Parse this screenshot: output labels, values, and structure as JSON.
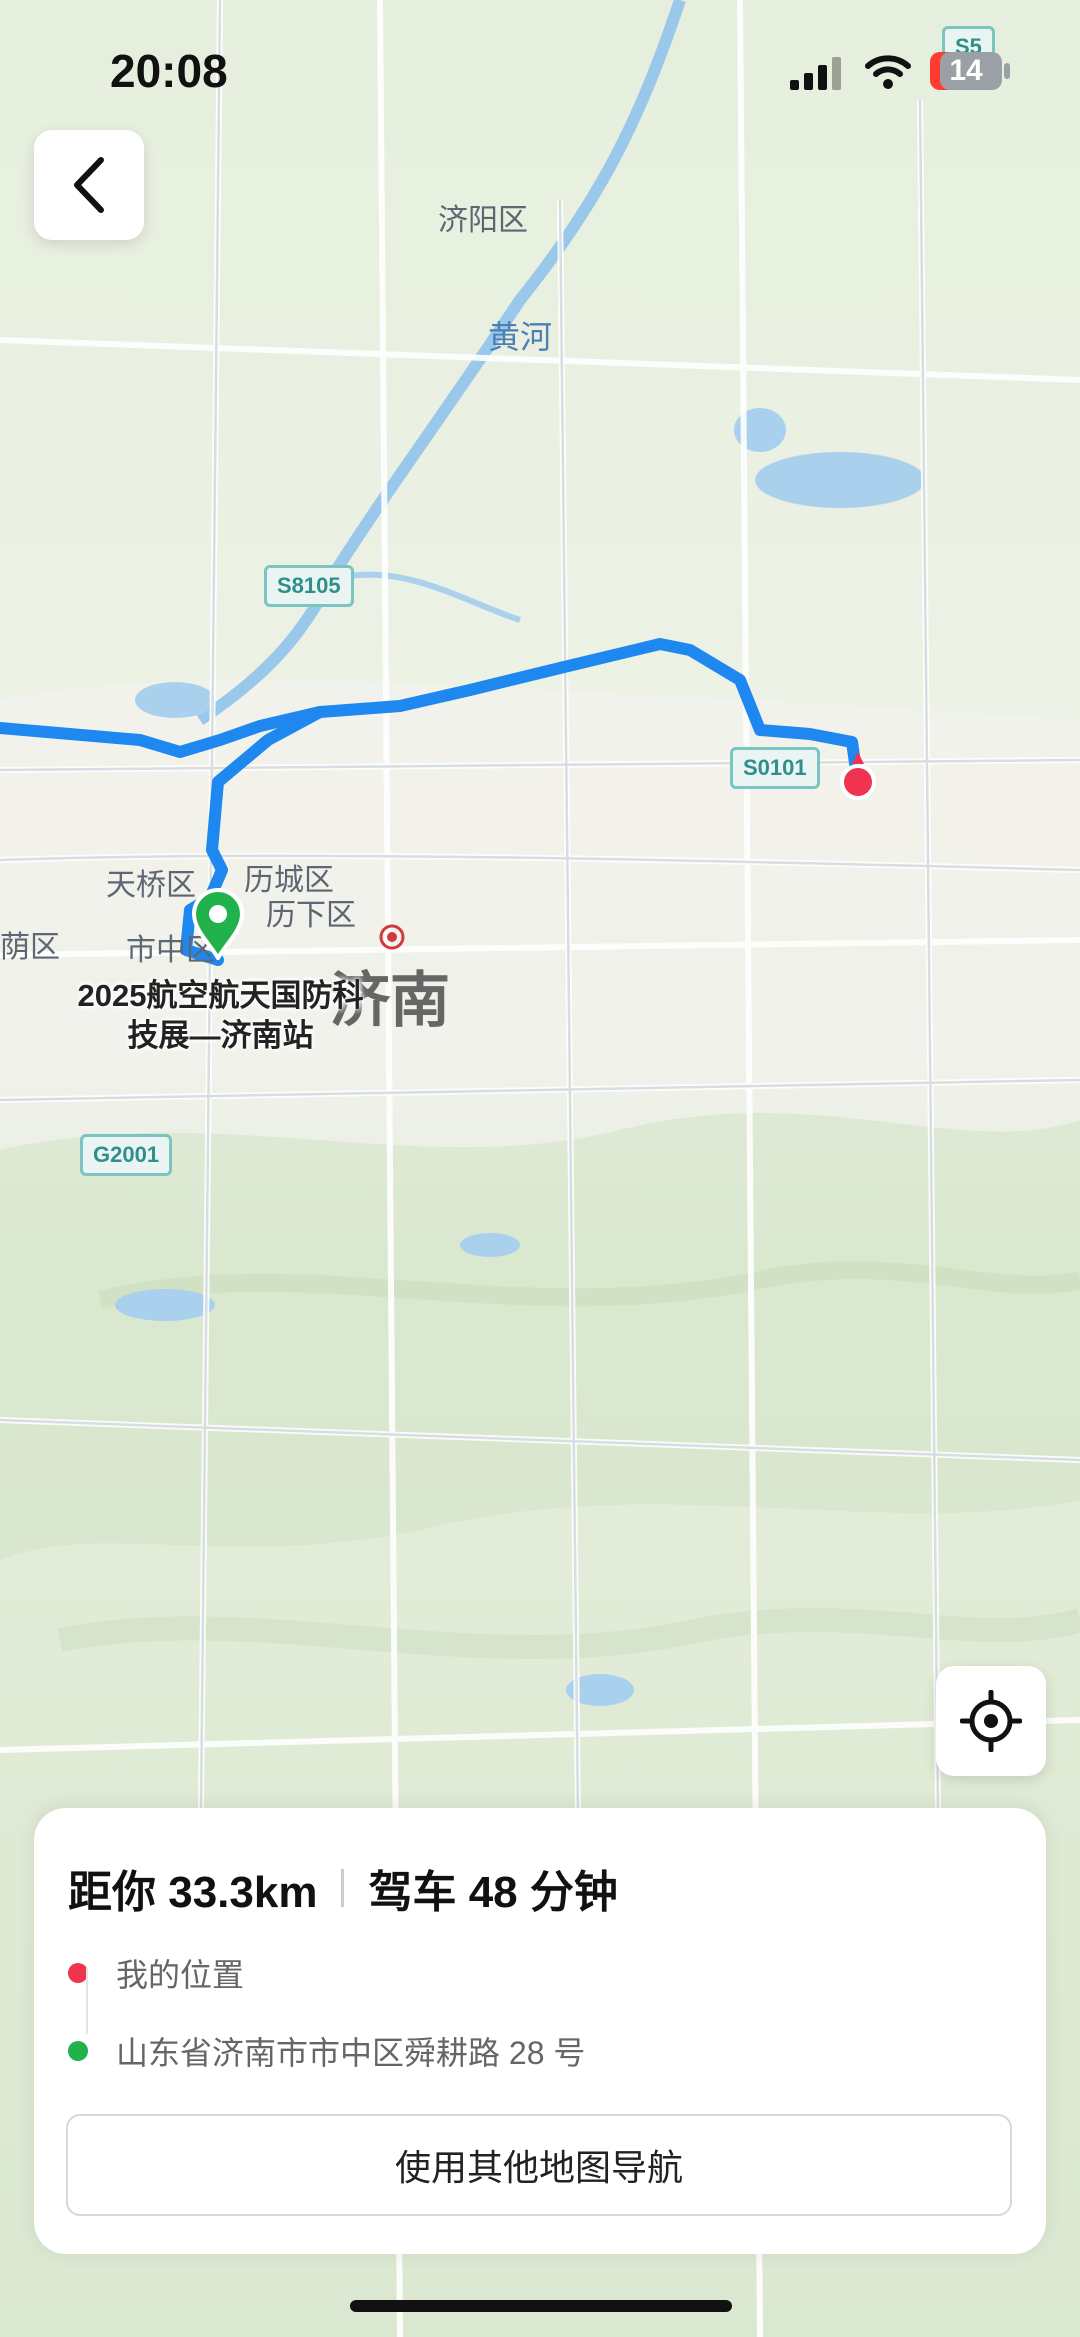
{
  "status_bar": {
    "time": "20:08",
    "battery_level": "14"
  },
  "map": {
    "labels": {
      "jiyang": "济阳区",
      "yellow_river": "黄河",
      "tianqiao": "天桥区",
      "licheng": "历城区",
      "lixia": "历下区",
      "shizhong": "市中区",
      "huaiyin_partial": "荫区",
      "jinan": "济南"
    },
    "road_shields": {
      "s5": "S5",
      "s8105": "S8105",
      "s0101": "S0101",
      "g2001": "G2001"
    },
    "poi_label_line1": "2025航空航天国防科",
    "poi_label_line2": "技展—济南站",
    "colors": {
      "route": "#1e88f0",
      "destination_pin": "#22b24c",
      "my_location": "#f0334f"
    }
  },
  "card": {
    "distance": "距你 33.3km",
    "duration": "驾车 48 分钟",
    "origin": "我的位置",
    "destination": "山东省济南市市中区舜耕路 28 号",
    "nav_button": "使用其他地图导航"
  }
}
